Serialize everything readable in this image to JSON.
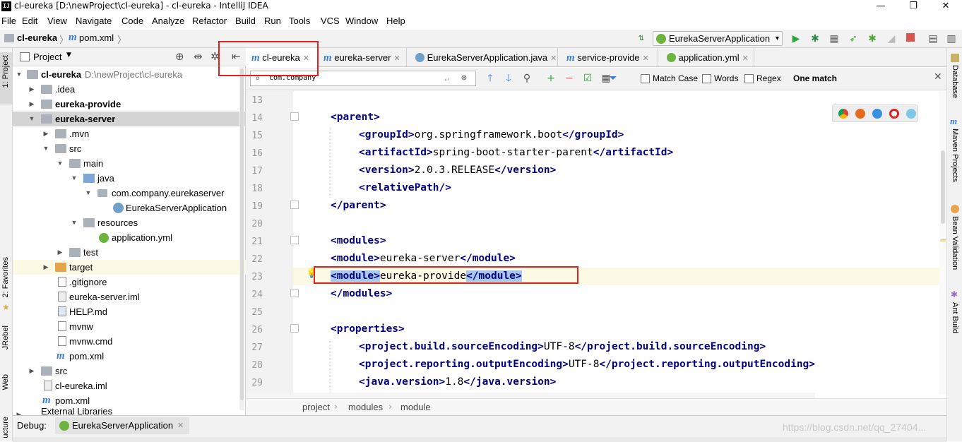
{
  "window": {
    "title": "cl-eureka [D:\\newProject\\cl-eureka] - cl-eureka - IntelliJ IDEA",
    "app_icon": "IJ",
    "minimize": "—",
    "maximize": "❐",
    "close": "✕"
  },
  "menu": [
    "File",
    "Edit",
    "View",
    "Navigate",
    "Code",
    "Analyze",
    "Refactor",
    "Build",
    "Run",
    "Tools",
    "VCS",
    "Window",
    "Help"
  ],
  "nav": {
    "crumb_project": "cl-eureka",
    "crumb_sep": "〉",
    "crumb_file": "pom.xml",
    "run_config": "EurekaServerApplication"
  },
  "left_strip": {
    "project": "1: Project",
    "favorites": "2: Favorites",
    "jrebel": "JRebel",
    "web": "Web",
    "structure": "ucture"
  },
  "right_strip": {
    "database": "Database",
    "maven": "Maven Projects",
    "bean": "Bean Validation",
    "ant": "Ant Build"
  },
  "project_panel": {
    "header": "Project",
    "rows": [
      {
        "label": "cl-eureka",
        "extra": "D:\\newProject\\cl-eureka"
      },
      {
        "label": ".idea"
      },
      {
        "label": "eureka-provide"
      },
      {
        "label": "eureka-server"
      },
      {
        "label": ".mvn"
      },
      {
        "label": "src"
      },
      {
        "label": "main"
      },
      {
        "label": "java"
      },
      {
        "label": "com.company.eurekaserver"
      },
      {
        "label": "EurekaServerApplication"
      },
      {
        "label": "resources"
      },
      {
        "label": "application.yml"
      },
      {
        "label": "test"
      },
      {
        "label": "target"
      },
      {
        "label": ".gitignore"
      },
      {
        "label": "eureka-server.iml"
      },
      {
        "label": "HELP.md"
      },
      {
        "label": "mvnw"
      },
      {
        "label": "mvnw.cmd"
      },
      {
        "label": "pom.xml"
      },
      {
        "label": "src"
      },
      {
        "label": "cl-eureka.iml"
      },
      {
        "label": "pom.xml"
      },
      {
        "label": "External Libraries"
      }
    ]
  },
  "tabs": [
    {
      "label": "cl-eureka"
    },
    {
      "label": "eureka-server"
    },
    {
      "label": "EurekaServerApplication.java"
    },
    {
      "label": "service-provide"
    },
    {
      "label": "application.yml"
    }
  ],
  "find": {
    "query": "com.company",
    "match_case": "Match Case",
    "words": "Words",
    "regex": "Regex",
    "result": "One match"
  },
  "editor": {
    "line_numbers": [
      "13",
      "14",
      "15",
      "16",
      "17",
      "18",
      "19",
      "20",
      "21",
      "22",
      "23",
      "24",
      "25",
      "26",
      "27",
      "28",
      "29"
    ],
    "breadcrumb": [
      "project",
      "modules",
      "module"
    ]
  },
  "bottom": {
    "debug_label": "Debug:",
    "debug_tab": "EurekaServerApplication",
    "watermark": "https://blog.csdn.net/qq_27404..."
  }
}
